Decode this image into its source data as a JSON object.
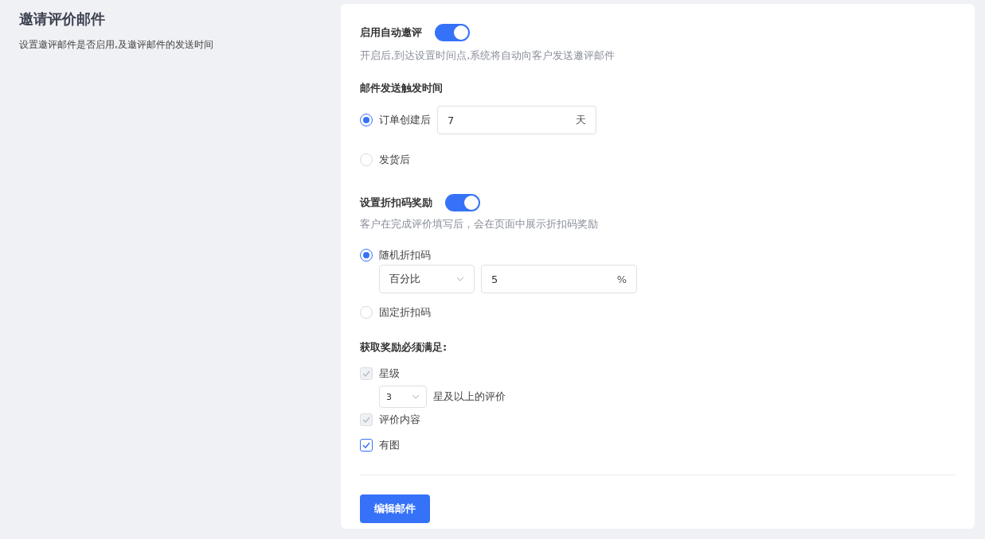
{
  "intro": {
    "title": "邀请评价邮件",
    "description": "设置邀评邮件是否启用,及邀评邮件的发送时间"
  },
  "auto_invite": {
    "label": "启用自动邀评",
    "on": true,
    "description": "开启后,到达设置时间点,系统将自动向客户发送邀评邮件"
  },
  "trigger": {
    "heading": "邮件发送触发时间",
    "options": [
      {
        "label": "订单创建后",
        "selected": true,
        "field": {
          "value": "7",
          "suffix": "天"
        }
      },
      {
        "label": "发货后",
        "selected": false
      }
    ]
  },
  "discount": {
    "label": "设置折扣码奖励",
    "on": true,
    "description": "客户在完成评价填写后，会在页面中展示折扣码奖励",
    "options": [
      {
        "label": "随机折扣码",
        "selected": true,
        "type_select": "百分比",
        "field": {
          "value": "5",
          "suffix": "%"
        }
      },
      {
        "label": "固定折扣码",
        "selected": false
      }
    ]
  },
  "requirements": {
    "heading": "获取奖励必须满足:",
    "items": [
      {
        "label": "星级",
        "checked": true,
        "disabled": true,
        "select": "3",
        "select_suffix": "星及以上的评价"
      },
      {
        "label": "评价内容",
        "checked": true,
        "disabled": true
      },
      {
        "label": "有图",
        "checked": true,
        "disabled": false
      }
    ]
  },
  "button": "编辑邮件"
}
